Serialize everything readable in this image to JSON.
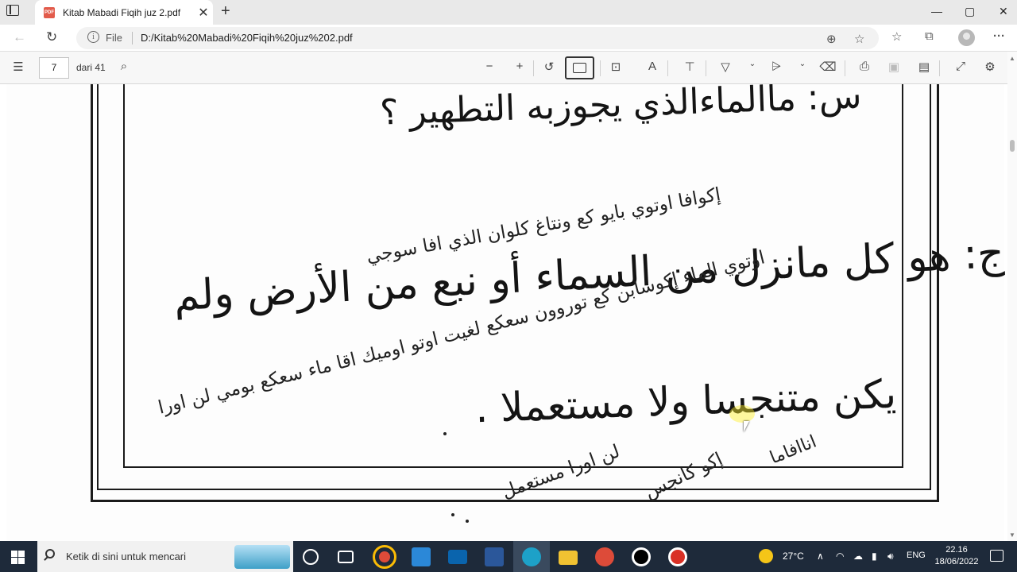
{
  "browser": {
    "tab_title": "Kitab Mabadi Fiqih juz 2.pdf",
    "tab_close": "✕",
    "new_tab": "+",
    "window_controls": [
      "—",
      "▢",
      "✕"
    ],
    "nav": {
      "back": "←",
      "refresh": "↻"
    },
    "address": {
      "scheme_label": "File",
      "url": "D:/Kitab%20Mabadi%20Fiqih%20juz%202.pdf"
    },
    "address_icons": [
      "zoom-icon",
      "favorite-add-icon",
      "favorites-icon",
      "collections-icon",
      "profile-icon",
      "more-icon"
    ],
    "more": "···"
  },
  "pdf_toolbar": {
    "current_page": "7",
    "total_label": "dari 41",
    "tools": [
      "contents-icon",
      "search-icon",
      "zoom-out-icon",
      "zoom-in-icon",
      "rotate-icon",
      "fit-icon",
      "page-view-icon",
      "read-aloud-icon",
      "text-icon",
      "draw-icon",
      "highlight-icon",
      "erase-icon",
      "print-icon",
      "save-icon",
      "save-as-icon",
      "fullscreen-icon",
      "settings-icon"
    ]
  },
  "document": {
    "question": "س: ماالماءالذي يجوزبه التطهير ؟",
    "answer_line1": "ج: هو كل مانزل من السماء أو نبع من الأرض ولم",
    "answer_line2": "يكن متنجسا ولا مستعملا .",
    "glosses": [
      "إكوافا اوتوي بايو كع ونتاغ كلوان الذي افا سوجي",
      "اوتوي الماء إكوسابن كع توروون سعكع لغيت اوتو اوميك اقا ماء سعكع بومي لن اورا",
      "اناافاما",
      "لن اورا مستعمل",
      "إكو كانجس"
    ]
  },
  "taskbar": {
    "search_placeholder": "Ketik di sini untuk mencari",
    "weather": "27°C",
    "language": "ENG",
    "time": "22.16",
    "date": "18/06/2022",
    "colors": {
      "chrome": "#dd4b39",
      "store": "#2b88d8",
      "mail": "#0a64ad",
      "word": "#2b579a",
      "edge": "#1da1c8",
      "explorer": "#f1c232",
      "record": "#d93025"
    }
  }
}
